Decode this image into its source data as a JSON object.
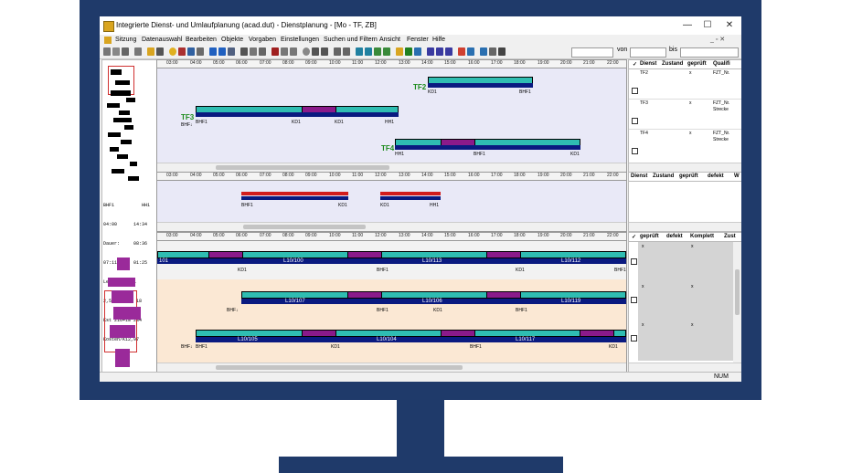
{
  "window": {
    "title": "Integrierte Dienst- und Umlaufplanung (acad.dut) - Dienstplanung - [Mo - TF, ZB]",
    "minimize": "—",
    "maximize": "☐",
    "close": "✕"
  },
  "menu": {
    "items": [
      "Sitzung",
      "Datenauswahl",
      "Bearbeiten",
      "Objekte",
      "Vorgaben",
      "Einstellungen",
      "Suchen und Filtern",
      "Ansicht",
      "Fenster",
      "Hilfe"
    ],
    "mdi_controls": "_ ▫ ✕"
  },
  "toolbar": {
    "von_label": "von",
    "bis_label": "bis"
  },
  "timeline": {
    "hours": [
      "03:00",
      "04:00",
      "05:00",
      "06:00",
      "07:00",
      "08:00",
      "09:00",
      "10:00",
      "11:00",
      "12:00",
      "13:00",
      "14:00",
      "15:00",
      "16:00",
      "17:00",
      "18:00",
      "19:00",
      "20:00",
      "21:00",
      "22:00"
    ]
  },
  "panel1": {
    "tf2": {
      "label": "TF2",
      "start": "KD1",
      "end": "BHF1"
    },
    "tf3": {
      "label": "TF3",
      "pre": "BHF↓",
      "a": "BHF1",
      "b": "KD1",
      "c": "KD1",
      "d": "HH1"
    },
    "tf4": {
      "label": "TF4",
      "a": "HH1",
      "b": "BHF1",
      "c": "KD1"
    }
  },
  "panel2": {
    "info": [
      "BHF1          HH1",
      "04:00      14:34",
      "Dauer:     08:36",
      "07:11      01:25",
      "Lenk00:07:11",
      "2,5  18+0   18",
      "Kst 216+18 234",
      "Kosten/K12,97"
    ],
    "bar1": {
      "a": "BHF1",
      "b": "KD1"
    },
    "bar2": {
      "a": "KD1",
      "b": "HH1"
    }
  },
  "panel3": {
    "row1": {
      "a": "101",
      "b": "L10/100",
      "c": "L10/113",
      "d": "L10/112",
      "e": "KD1",
      "f": "BHF1",
      "g": "KD1",
      "h": "BHF1"
    },
    "row2": {
      "a": "L10/107",
      "b": "L10/106",
      "c": "L10/119",
      "pre": "BHF↓",
      "d": "BHF1",
      "e": "KD1",
      "f": "BHF1"
    },
    "row3": {
      "pre": "BHF↓",
      "a": "L10/105",
      "b": "L10/104",
      "c": "L10/117",
      "d": "BHF1",
      "e": "KD1",
      "f": "BHF1",
      "g": "KD1"
    }
  },
  "right1": {
    "headers": [
      "✓",
      "Dienst",
      "Zustand",
      "geprüft",
      "Qualifi"
    ],
    "rows": [
      {
        "dienst": "TF2",
        "geprueft": "x",
        "qual": "FZT_Nr."
      },
      {
        "dienst": "TF3",
        "geprueft": "x",
        "qual": "FZT_Nr.",
        "qual2": "Strecke"
      },
      {
        "dienst": "TF4",
        "geprueft": "x",
        "qual": "FZT_Nr.",
        "qual2": "Strecke"
      }
    ]
  },
  "right2": {
    "headers": [
      "Dienst",
      "Zustand",
      "geprüft",
      "defekt",
      "W"
    ]
  },
  "right3": {
    "headers": [
      "✓",
      "geprüft",
      "defekt",
      "Komplett",
      "Zust"
    ],
    "x": "x"
  },
  "status": {
    "num": "NUM"
  }
}
